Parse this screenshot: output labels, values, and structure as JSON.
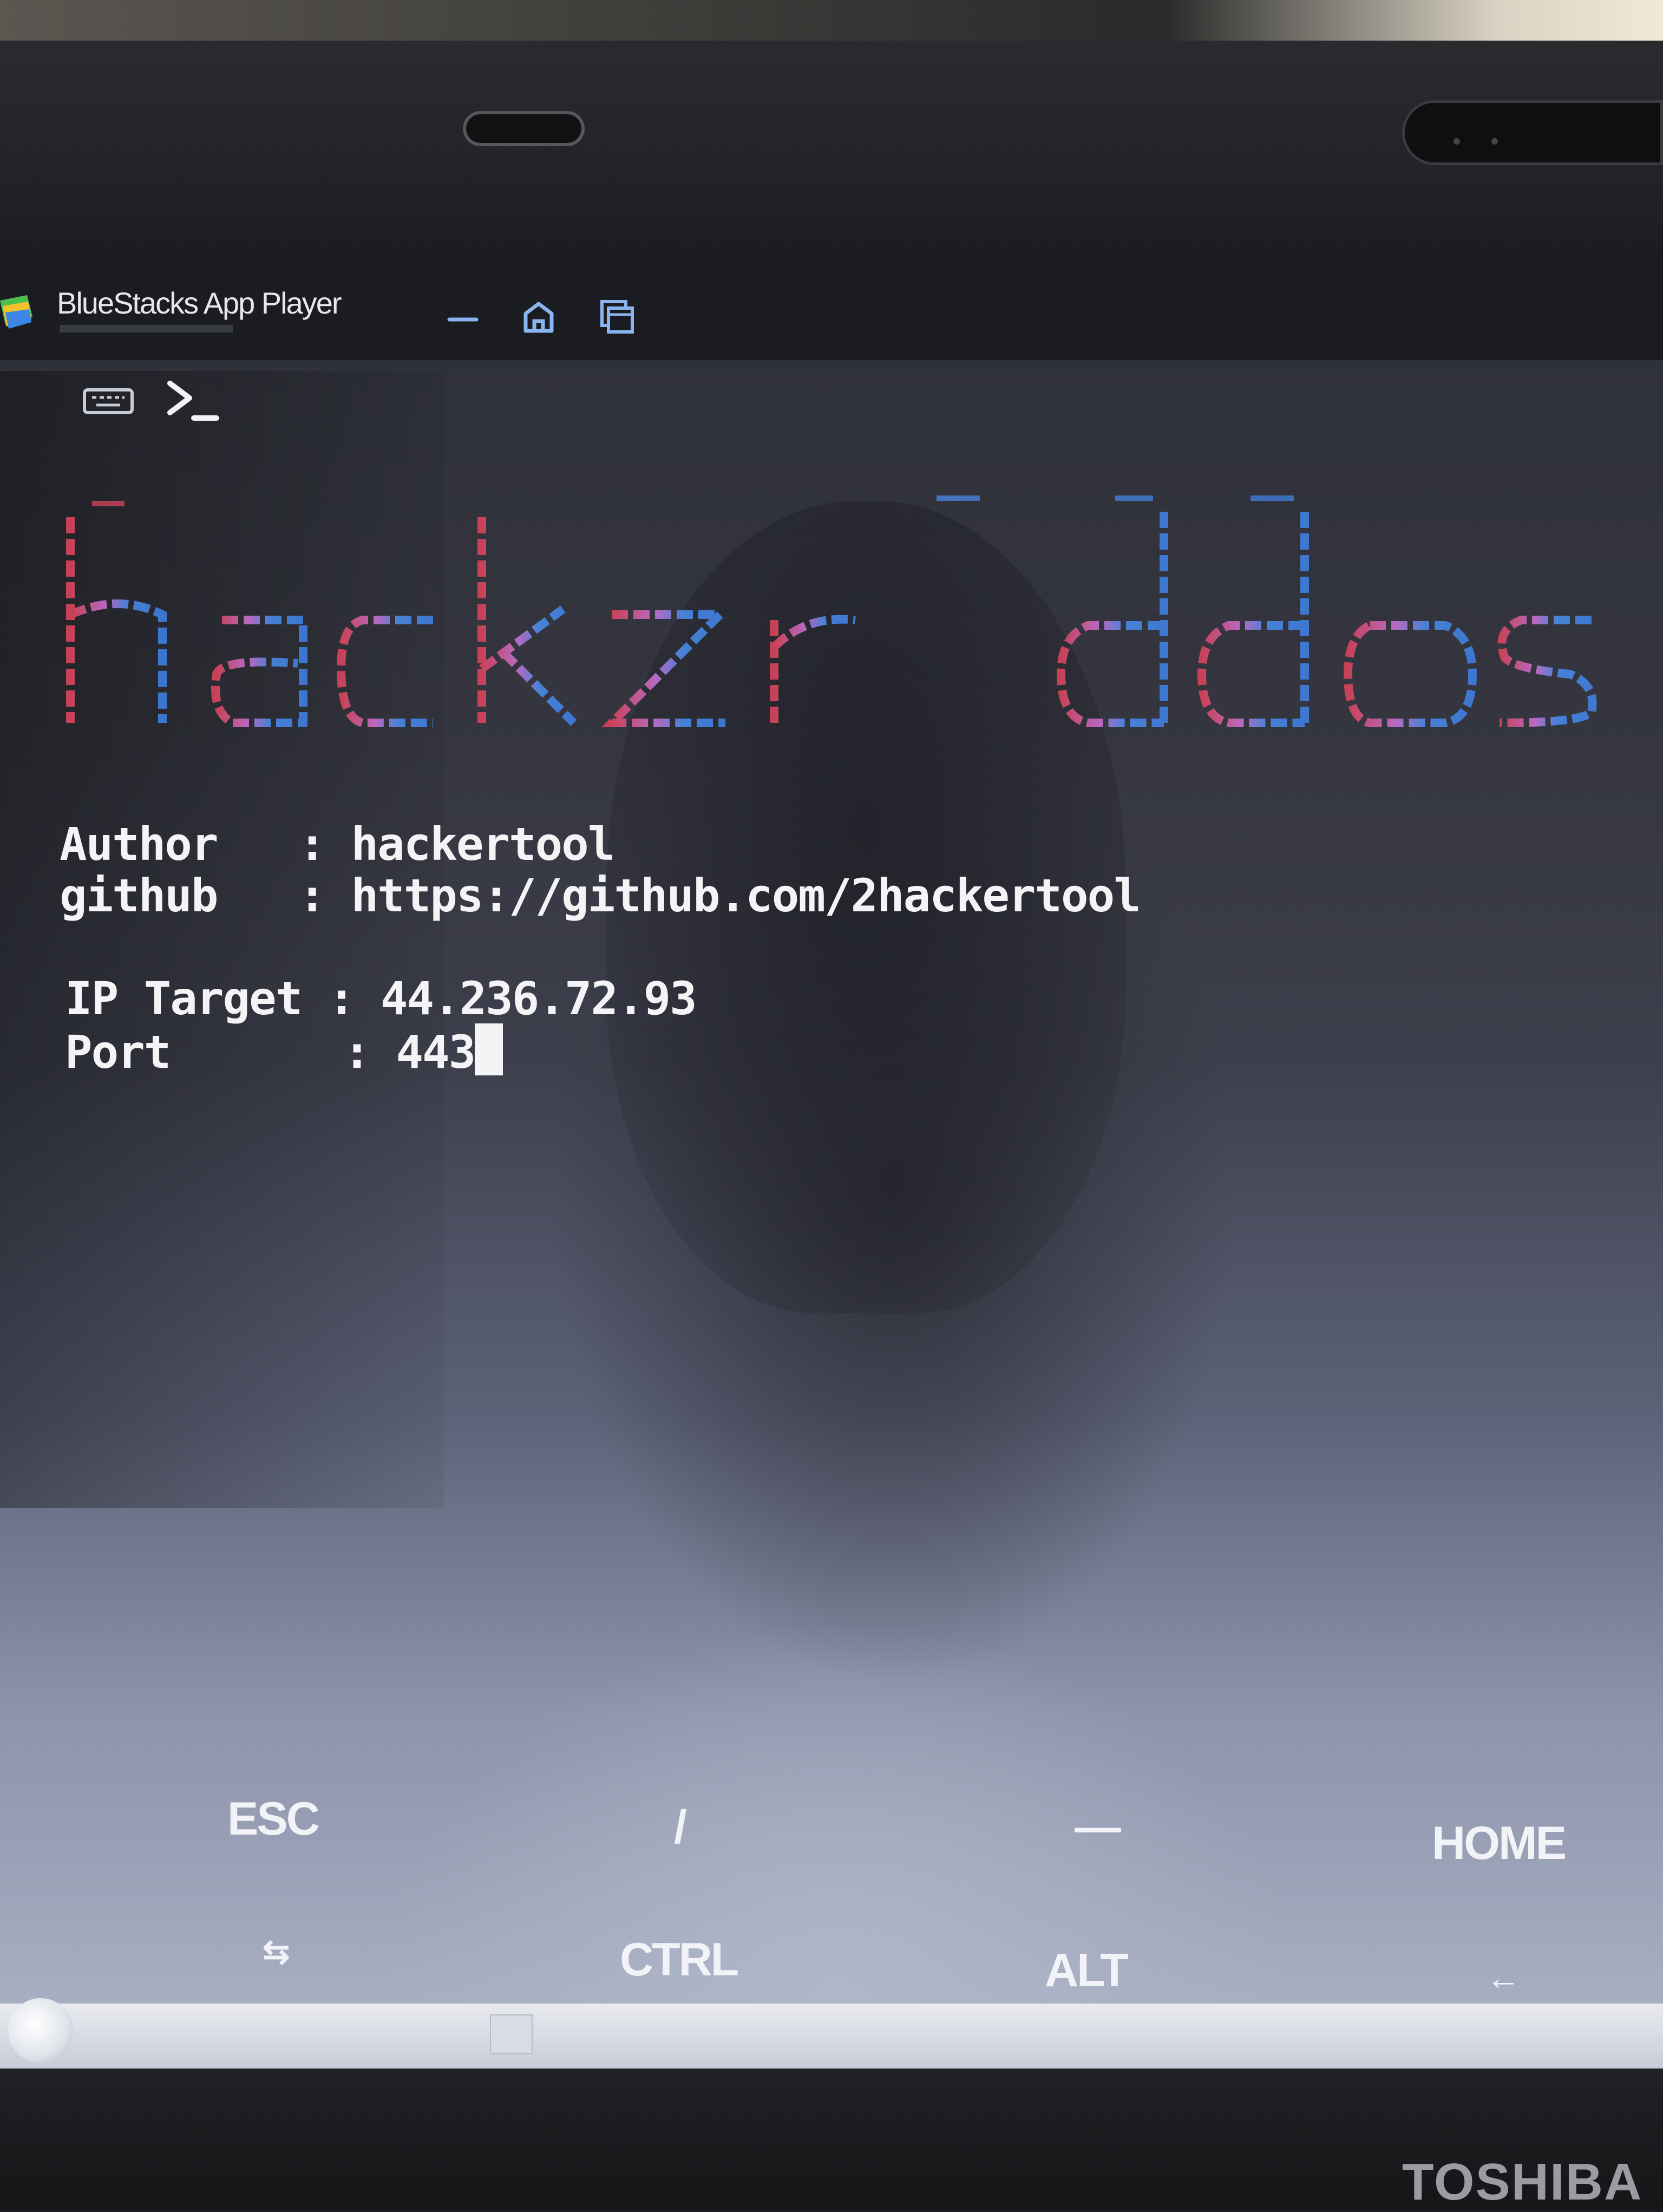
{
  "window": {
    "title": "BlueStacks App Player"
  },
  "titlebar_buttons": [
    {
      "name": "minimize",
      "icon": "minimize-icon"
    },
    {
      "name": "home",
      "icon": "home-icon"
    },
    {
      "name": "multi-instance",
      "icon": "multi-instance-icon"
    }
  ],
  "terminal_toolbar": {
    "keyboard_icon": "keyboard-icon",
    "prompt_icon": "terminal-prompt-icon"
  },
  "banner": {
    "text": "hackz-ddos",
    "colors": [
      "#d9445a",
      "#c86fd0",
      "#4a8be8"
    ]
  },
  "info": {
    "author_label": "Author",
    "author_sep": ":",
    "author_value": "hackertool",
    "github_label": "github",
    "github_sep": ":",
    "github_value": "https://github.com/2hackertool"
  },
  "input": {
    "ip_label": "IP Target",
    "ip_sep": ":",
    "ip_value": "44.236.72.93",
    "port_label": "Port",
    "port_sep": ":",
    "port_value": "443"
  },
  "extra_keys": {
    "row1": [
      "ESC",
      "/",
      "—",
      "HOME"
    ],
    "row2": [
      "⇆",
      "CTRL",
      "ALT",
      "←"
    ]
  },
  "brand": "TOSHIBA"
}
